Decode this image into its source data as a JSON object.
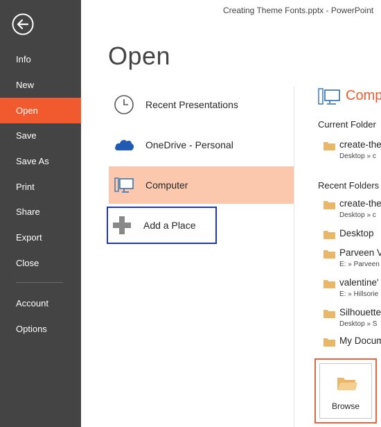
{
  "window_title": "Creating Theme Fonts.pptx - PowerPoint",
  "sidebar": {
    "back_icon": "back-arrow-icon",
    "items": [
      {
        "label": "Info"
      },
      {
        "label": "New"
      },
      {
        "label": "Open",
        "active": true
      },
      {
        "label": "Save"
      },
      {
        "label": "Save As"
      },
      {
        "label": "Print"
      },
      {
        "label": "Share"
      },
      {
        "label": "Export"
      },
      {
        "label": "Close"
      },
      {
        "label": "Account"
      },
      {
        "label": "Options"
      }
    ]
  },
  "page_title": "Open",
  "places": [
    {
      "label": "Recent Presentations",
      "icon": "clock-icon"
    },
    {
      "label": "OneDrive - Personal",
      "icon": "cloud-icon"
    },
    {
      "label": "Computer",
      "icon": "computer-icon",
      "selected": true
    },
    {
      "label": "Add a Place",
      "icon": "plus-icon",
      "focused": true
    }
  ],
  "right_panel": {
    "header": "Comp",
    "current_folder_title": "Current Folder",
    "current_folder": [
      {
        "name": "create-the",
        "path": "Desktop » c"
      }
    ],
    "recent_folders_title": "Recent Folders",
    "recent_folders": [
      {
        "name": "create-the",
        "path": "Desktop » c"
      },
      {
        "name": "Desktop",
        "path": ""
      },
      {
        "name": "Parveen V",
        "path": "E: » Parveen"
      },
      {
        "name": "valentine'",
        "path": "E: » Hillsorie"
      },
      {
        "name": "Silhouette",
        "path": "Desktop » S"
      },
      {
        "name": "My Docum",
        "path": ""
      }
    ],
    "browse_label": "Browse"
  },
  "colors": {
    "sidebar_bg": "#444444",
    "accent": "#f15a2e",
    "selected_place": "#fbc8ae",
    "focus_border": "#1e33c9",
    "folder": "#e8b76a"
  }
}
